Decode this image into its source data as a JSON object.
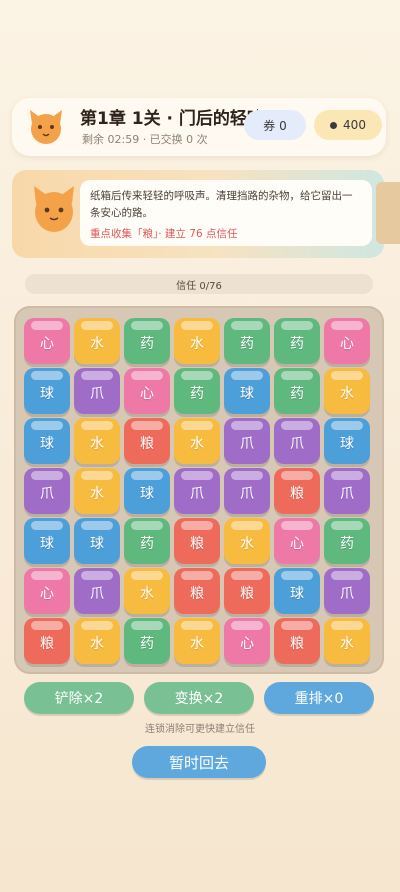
{
  "header": {
    "title": "第1章 1关 · 门后的轻响",
    "subtitle": "剩余 02:59 · 已交换 0 次",
    "ticket_label": "券 0",
    "coin_count": "400"
  },
  "story": {
    "text": "纸箱后传来轻轻的呼吸声。清理挡路的杂物，给它留出一条安心的路。",
    "goal": "重点收集「粮」· 建立 76 点信任"
  },
  "trust": {
    "label": "信任 0/76",
    "current": 0,
    "max": 76
  },
  "tile_types": {
    "心": {
      "color": "#ee78a6",
      "name": "heart"
    },
    "水": {
      "color": "#f7bb3f",
      "name": "water"
    },
    "药": {
      "color": "#5fb87d",
      "name": "medicine"
    },
    "球": {
      "color": "#4d9fd9",
      "name": "ball"
    },
    "爪": {
      "color": "#9f6cc8",
      "name": "claw"
    },
    "粮": {
      "color": "#ee6b5c",
      "name": "food"
    }
  },
  "board": [
    [
      "心",
      "水",
      "药",
      "水",
      "药",
      "药",
      "心"
    ],
    [
      "球",
      "爪",
      "心",
      "药",
      "球",
      "药",
      "水"
    ],
    [
      "球",
      "水",
      "粮",
      "水",
      "爪",
      "爪",
      "球"
    ],
    [
      "爪",
      "水",
      "球",
      "爪",
      "爪",
      "粮",
      "爪"
    ],
    [
      "球",
      "球",
      "药",
      "粮",
      "水",
      "心",
      "药"
    ],
    [
      "心",
      "爪",
      "水",
      "粮",
      "粮",
      "球",
      "爪"
    ],
    [
      "粮",
      "水",
      "药",
      "水",
      "心",
      "粮",
      "水"
    ]
  ],
  "tools": {
    "remove": "铲除×2",
    "swap": "变换×2",
    "shuffle": "重排×0"
  },
  "hint": "连锁消除可更快建立信任",
  "leave_label": "暂时回去",
  "colors": {
    "cat_orange": "#f4a24a",
    "green_button": "#79c194",
    "blue_button": "#5ea8dd"
  }
}
